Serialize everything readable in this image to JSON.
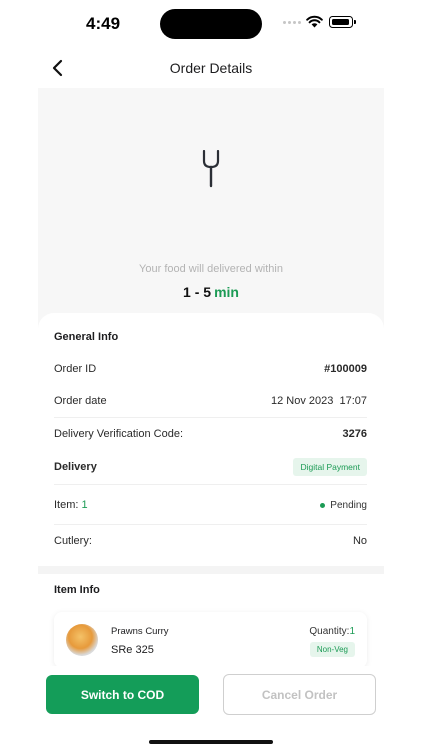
{
  "status_bar": {
    "time": "4:49"
  },
  "header": {
    "title": "Order Details",
    "back_icon": "chevron-left-icon"
  },
  "hero": {
    "icon": "fork-icon",
    "deliver_text": "Your food will delivered within",
    "eta_range": "1 - 5",
    "eta_unit": "min"
  },
  "general_info": {
    "title": "General Info",
    "order_id_label": "Order ID",
    "order_id_value": "#100009",
    "order_date_label": "Order date",
    "order_date_value": "12 Nov 2023  17:07",
    "verification_label": "Delivery Verification Code:",
    "verification_value": "3276",
    "delivery_label": "Delivery",
    "payment_badge": "Digital Payment",
    "item_label": "Item:",
    "item_count": "1",
    "status": "Pending",
    "cutlery_label": "Cutlery:",
    "cutlery_value": "No"
  },
  "item_info": {
    "title": "Item Info",
    "items": [
      {
        "name": "Prawns Curry",
        "price": "SRe 325",
        "quantity_label": "Quantity:",
        "quantity": "1",
        "badge": "Non-Veg"
      }
    ]
  },
  "actions": {
    "primary_label": "Switch to COD",
    "secondary_label": "Cancel Order"
  },
  "colors": {
    "accent_green": "#149d59",
    "badge_bg": "#e6f5ec"
  }
}
